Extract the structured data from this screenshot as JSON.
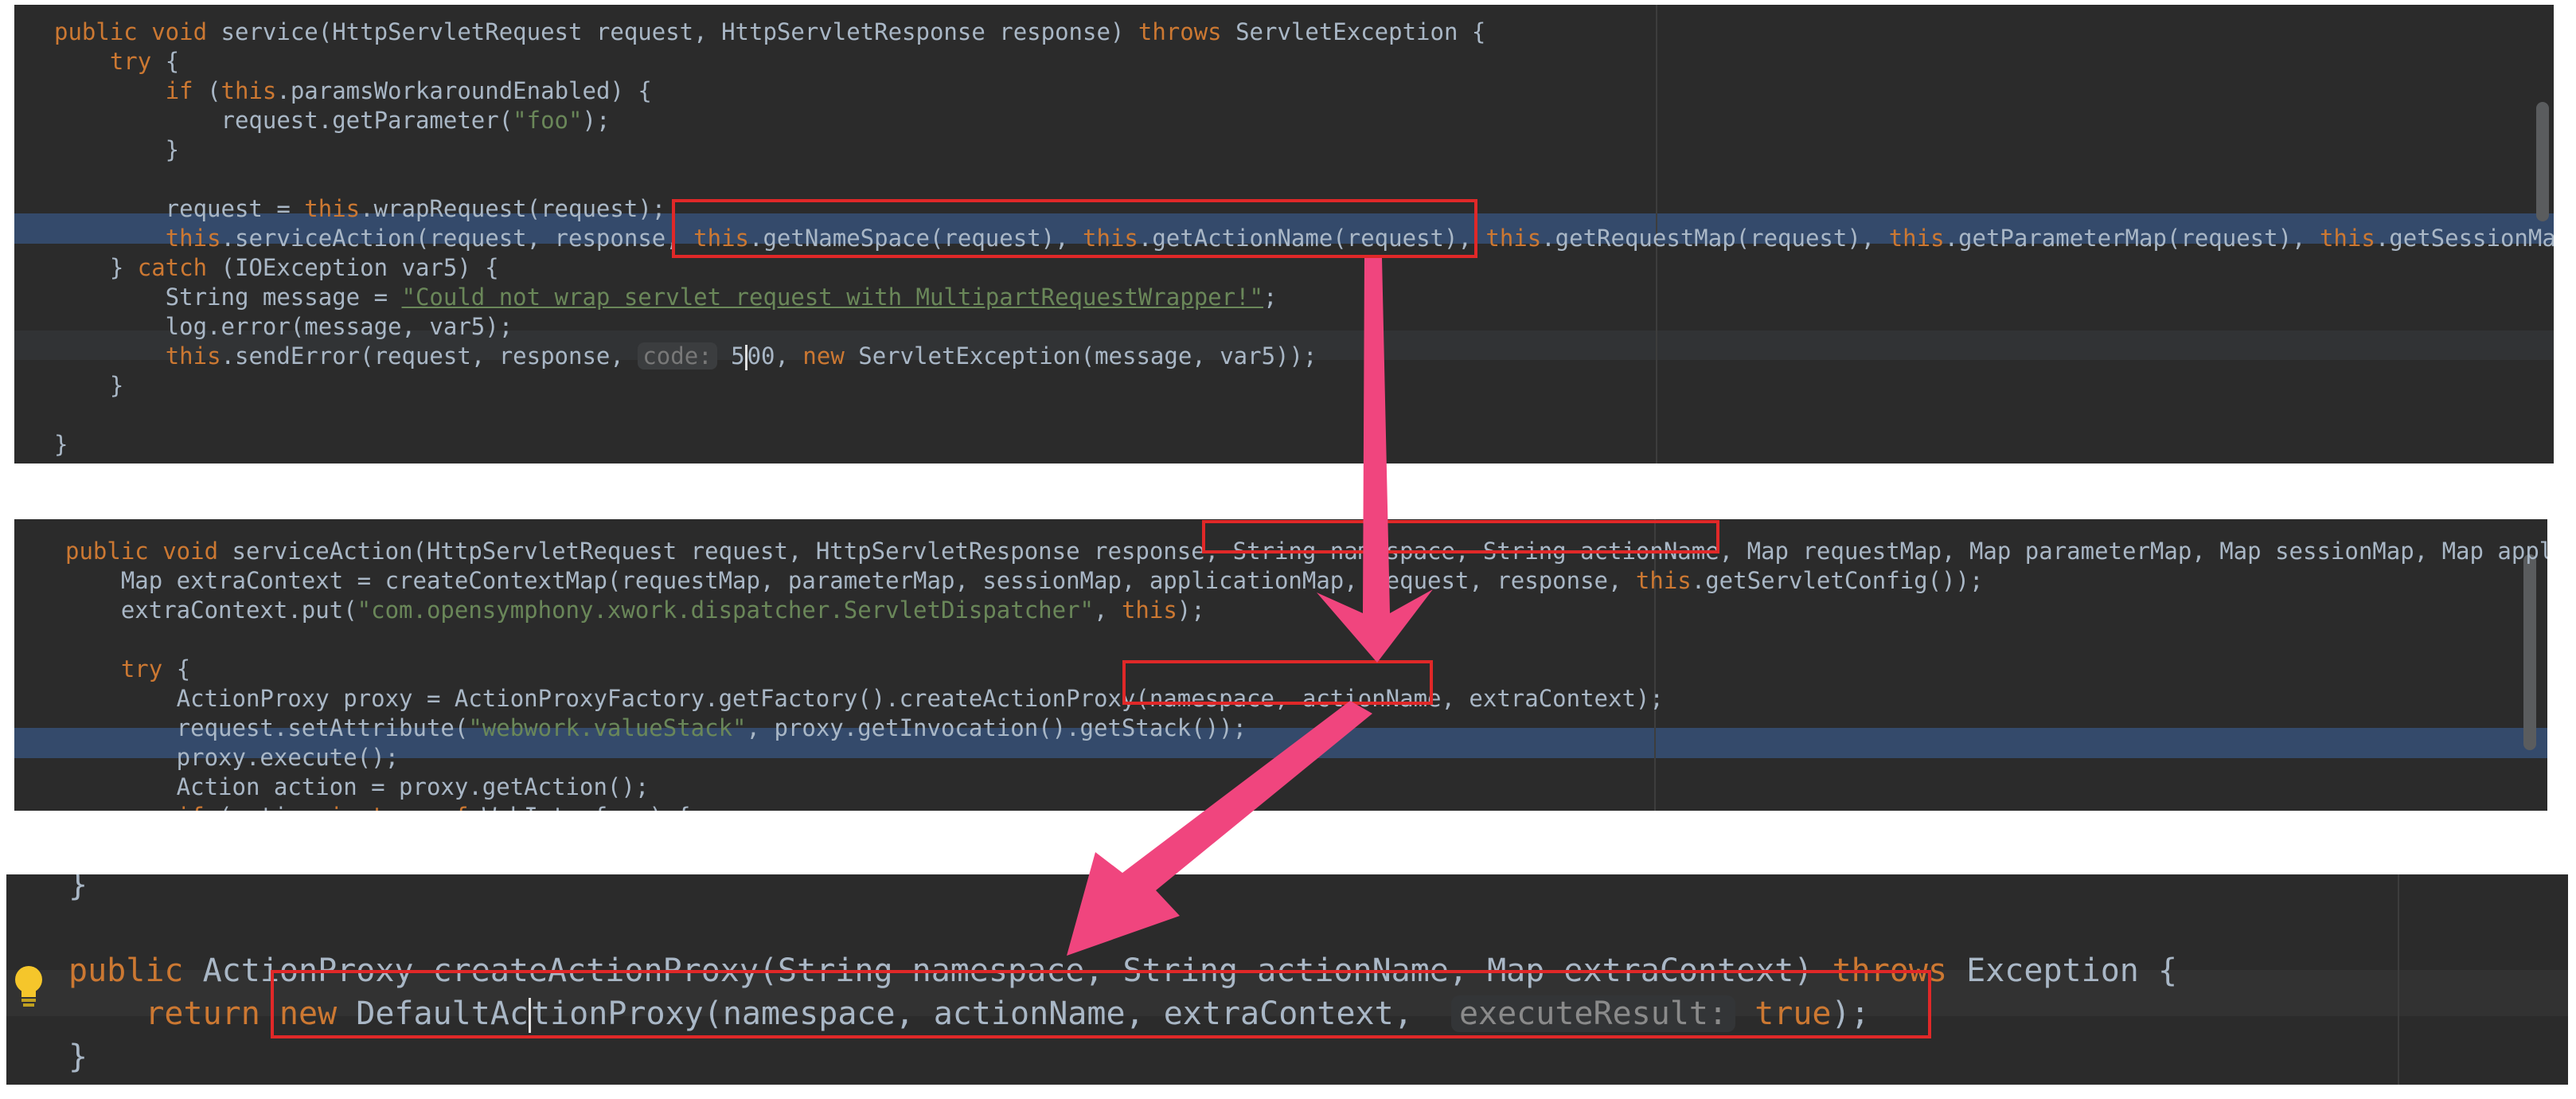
{
  "panel1": {
    "lines": [
      [
        {
          "t": "public void",
          "c": "kw"
        },
        {
          "t": " service(HttpServletRequest request, HttpServletResponse response) "
        },
        {
          "t": "throws",
          "c": "kw"
        },
        {
          "t": " ServletException {"
        }
      ],
      [
        {
          "t": "    "
        },
        {
          "t": "try",
          "c": "kw"
        },
        {
          "t": " {"
        }
      ],
      [
        {
          "t": "        "
        },
        {
          "t": "if",
          "c": "kw"
        },
        {
          "t": " ("
        },
        {
          "t": "this",
          "c": "kw"
        },
        {
          "t": ".paramsWorkaroundEnabled) {"
        }
      ],
      [
        {
          "t": "            request.getParameter("
        },
        {
          "t": "\"foo\"",
          "c": "str"
        },
        {
          "t": ");"
        }
      ],
      [
        {
          "t": "        }"
        }
      ],
      [
        {
          "t": ""
        }
      ],
      [
        {
          "t": "        request = "
        },
        {
          "t": "this",
          "c": "kw"
        },
        {
          "t": ".wrapRequest(request);"
        }
      ],
      [
        {
          "t": "        "
        },
        {
          "t": "this",
          "c": "kw"
        },
        {
          "t": ".serviceAction(request, response, "
        },
        {
          "t": "this",
          "c": "kw"
        },
        {
          "t": ".getNameSpace(request), "
        },
        {
          "t": "this",
          "c": "kw"
        },
        {
          "t": ".getActionName(request), "
        },
        {
          "t": "this",
          "c": "kw"
        },
        {
          "t": ".getRequestMap(request), "
        },
        {
          "t": "this",
          "c": "kw"
        },
        {
          "t": ".getParameterMap(request), "
        },
        {
          "t": "this",
          "c": "kw"
        },
        {
          "t": ".getSessionMap"
        }
      ],
      [
        {
          "t": "    } "
        },
        {
          "t": "catch",
          "c": "kw"
        },
        {
          "t": " (IOException var5) {"
        }
      ],
      [
        {
          "t": "        String message = "
        },
        {
          "t": "\"Could not wrap servlet request with MultipartRequestWrapper!\"",
          "c": "link"
        },
        {
          "t": ";"
        }
      ],
      [
        {
          "t": "        log.error(message, var5);"
        }
      ],
      [
        {
          "t": "        "
        },
        {
          "t": "this",
          "c": "kw"
        },
        {
          "t": ".sendError(request, response, "
        },
        {
          "t": "code:",
          "c": "hint"
        },
        {
          "t": " 5"
        },
        {
          "t": "",
          "c": "caret"
        },
        {
          "t": "00, "
        },
        {
          "t": "new",
          "c": "kw"
        },
        {
          "t": " ServletException(message, var5));"
        }
      ],
      [
        {
          "t": "    }"
        }
      ],
      [
        {
          "t": ""
        }
      ],
      [
        {
          "t": "}"
        }
      ]
    ]
  },
  "panel2": {
    "lines": [
      [
        {
          "t": "public void",
          "c": "kw"
        },
        {
          "t": " serviceAction(HttpServletRequest request, HttpServletResponse response, String namespace, String actionName, Map requestMap, Map parameterMap, Map sessionMap, Map applic"
        }
      ],
      [
        {
          "t": "    Map extraContext = createContextMap(requestMap, parameterMap, sessionMap, applicationMap, request, response, "
        },
        {
          "t": "this",
          "c": "kw"
        },
        {
          "t": ".getServletConfig());"
        }
      ],
      [
        {
          "t": "    extraContext.put("
        },
        {
          "t": "\"com.opensymphony.xwork.dispatcher.ServletDispatcher\"",
          "c": "str"
        },
        {
          "t": ", "
        },
        {
          "t": "this",
          "c": "kw"
        },
        {
          "t": ");"
        }
      ],
      [
        {
          "t": ""
        }
      ],
      [
        {
          "t": "    "
        },
        {
          "t": "try",
          "c": "kw"
        },
        {
          "t": " {"
        }
      ],
      [
        {
          "t": "        ActionProxy proxy = ActionProxyFactory.getFactory().createActionProxy(namespace, actionName, extraContext);"
        }
      ],
      [
        {
          "t": "        request.setAttribute("
        },
        {
          "t": "\"webwork.valueStack\"",
          "c": "str"
        },
        {
          "t": ", proxy.getInvocation().getStack());"
        }
      ],
      [
        {
          "t": "        proxy.execute();"
        }
      ],
      [
        {
          "t": "        Action action = proxy.getAction();"
        }
      ],
      [
        {
          "t": "        "
        },
        {
          "t": "if",
          "c": "kw"
        },
        {
          "t": " (action "
        },
        {
          "t": "instanceof",
          "c": "kw"
        },
        {
          "t": " WebInterface) {"
        }
      ]
    ]
  },
  "panel3": {
    "lines": [
      [
        {
          "t": "}"
        }
      ],
      [
        {
          "t": ""
        }
      ],
      [
        {
          "t": "public",
          "c": "kw"
        },
        {
          "t": " ActionProxy createActionProxy(String namespace, String actionName, Map extraContext) "
        },
        {
          "t": "throws",
          "c": "kw"
        },
        {
          "t": " Exception {"
        }
      ],
      [
        {
          "t": "    "
        },
        {
          "t": "return",
          "c": "kw"
        },
        {
          "t": " "
        },
        {
          "t": "new",
          "c": "kw"
        },
        {
          "t": " DefaultAc"
        },
        {
          "t": "",
          "c": "caret"
        },
        {
          "t": "tionProxy(namespace, actionName, extraContext,  "
        },
        {
          "t": "executeResult:",
          "c": "hint-big"
        },
        {
          "t": " "
        },
        {
          "t": "true",
          "c": "kw"
        },
        {
          "t": ");"
        }
      ],
      [
        {
          "t": "}"
        }
      ]
    ]
  },
  "colors": {
    "background": "#2b2b2b",
    "keyword": "#cc7832",
    "string": "#6a8759",
    "text": "#a9b7c6",
    "highlight_row": "#344a6b",
    "red_box": "#e02828",
    "arrow": "#f0457e"
  },
  "icons": {
    "bulb": "lightbulb-icon"
  }
}
